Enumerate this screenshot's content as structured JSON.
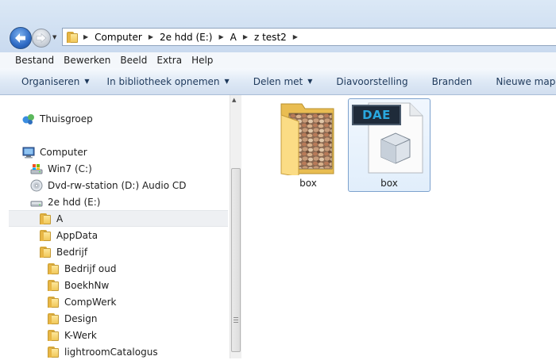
{
  "address": {
    "crumbs": [
      "Computer",
      "2e hdd (E:)",
      "A",
      "z test2"
    ]
  },
  "menu": [
    "Bestand",
    "Bewerken",
    "Beeld",
    "Extra",
    "Help"
  ],
  "commands": {
    "organize": "Organiseren",
    "library": "In bibliotheek opnemen",
    "share": "Delen met",
    "slideshow": "Diavoorstelling",
    "burn": "Branden",
    "new_folder": "Nieuwe map"
  },
  "tree": {
    "homegroup": "Thuisgroep",
    "computer": "Computer",
    "drive_c": "Win7 (C:)",
    "drive_d": "Dvd-rw-station (D:) Audio CD",
    "drive_e": "2e hdd (E:)",
    "folders": [
      "A",
      "AppData",
      "Bedrijf"
    ],
    "subfolders": [
      "Bedrijf oud",
      "BoekhNw",
      "CompWerk",
      "Design",
      "K-Werk",
      "lightroomCatalogus"
    ]
  },
  "files": [
    {
      "name": "box",
      "type": "folder"
    },
    {
      "name": "box",
      "type": "dae",
      "badge": "DAE"
    }
  ],
  "colors": {
    "accent": "#1e395b",
    "selection": "#7da2ce"
  }
}
